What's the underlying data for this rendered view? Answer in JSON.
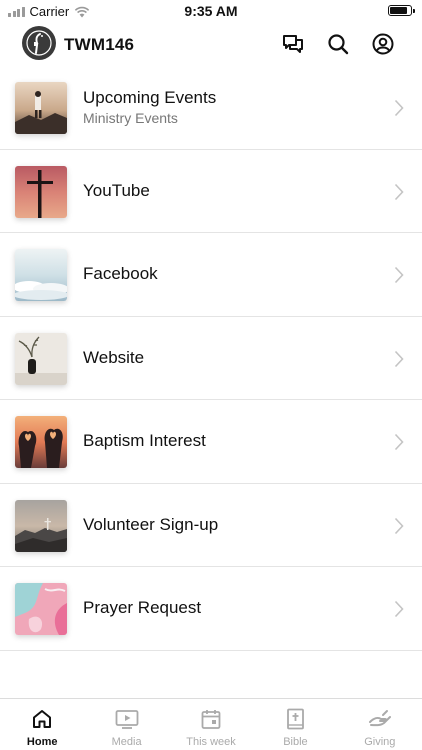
{
  "status_bar": {
    "carrier": "Carrier",
    "time": "9:35 AM",
    "battery_level": 0.9
  },
  "header": {
    "title": "TWM146",
    "icons": [
      "chat-bubbles-icon",
      "search-icon",
      "profile-icon"
    ]
  },
  "menu": {
    "items": [
      {
        "title": "Upcoming Events",
        "subtitle": "Ministry Events",
        "image": "person-on-rocks-photo"
      },
      {
        "title": "YouTube",
        "subtitle": "",
        "image": "cross-sunset-photo"
      },
      {
        "title": "Facebook",
        "subtitle": "",
        "image": "clouds-sky-photo"
      },
      {
        "title": "Website",
        "subtitle": "",
        "image": "vase-plant-photo"
      },
      {
        "title": "Baptism Interest",
        "subtitle": "",
        "image": "heart-hands-sunset-photo"
      },
      {
        "title": "Volunteer Sign-up",
        "subtitle": "",
        "image": "hilltop-cross-photo"
      },
      {
        "title": "Prayer Request",
        "subtitle": "",
        "image": "pastel-paint-photo"
      }
    ]
  },
  "tabs": [
    {
      "label": "Home",
      "icon": "home-icon",
      "active": true
    },
    {
      "label": "Media",
      "icon": "play-screen-icon",
      "active": false
    },
    {
      "label": "This week",
      "icon": "calendar-icon",
      "active": false
    },
    {
      "label": "Bible",
      "icon": "bible-icon",
      "active": false
    },
    {
      "label": "Giving",
      "icon": "giving-hand-icon",
      "active": false
    }
  ],
  "colors": {
    "text": "#111111",
    "muted": "#777777",
    "tab_inactive": "#aaaaaa",
    "divider": "#e4e4e4"
  }
}
